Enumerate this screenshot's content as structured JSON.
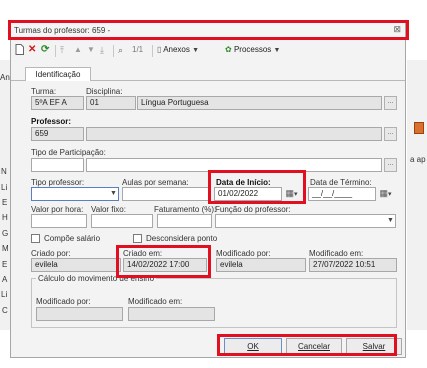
{
  "background": {
    "left_labels": [
      "An",
      "N",
      "Li",
      "E",
      "H",
      "G",
      "M",
      "E",
      "A",
      "Li",
      "C"
    ],
    "right_label": "a ap"
  },
  "dialog": {
    "title": "Turmas do professor: 659 -",
    "close_glyph": "⊠"
  },
  "toolbar": {
    "page_counter": "1/1",
    "anexos_label": "Anexos",
    "processos_label": "Processos"
  },
  "tabs": [
    {
      "label": "Identificação"
    }
  ],
  "form": {
    "turma": {
      "label": "Turma:",
      "value": "5ºA EF A"
    },
    "disciplina": {
      "label": "Disciplina:",
      "code": "01",
      "name": "Língua Portuguesa"
    },
    "professor": {
      "label": "Professor:",
      "code": "659",
      "name": ""
    },
    "tipo_participacao": {
      "label": "Tipo de Participação:",
      "value": ""
    },
    "tipo_professor": {
      "label": "Tipo professor:",
      "value": ""
    },
    "aulas_semana": {
      "label": "Aulas por semana:",
      "value": ""
    },
    "data_inicio": {
      "label": "Data de Início:",
      "value": "01/02/2022"
    },
    "data_termino": {
      "label": "Data de Término:",
      "value": "__/__/____"
    },
    "valor_hora": {
      "label": "Valor por hora:",
      "value": ""
    },
    "valor_fixo": {
      "label": "Valor fixo:",
      "value": ""
    },
    "faturamento": {
      "label": "Faturamento (%):",
      "value": ""
    },
    "funcao_professor": {
      "label": "Função do professor:",
      "value": ""
    },
    "compoe_salario": {
      "label": "Compõe salário",
      "checked": false
    },
    "desconsidera_ponto": {
      "label": "Desconsidera ponto",
      "checked": false
    },
    "criado_por": {
      "label": "Criado por:",
      "value": "evilela"
    },
    "criado_em": {
      "label": "Criado em:",
      "value": "14/02/2022 17:00"
    },
    "modificado_por": {
      "label": "Modificado por:",
      "value": "evilela"
    },
    "modificado_em": {
      "label": "Modificado em:",
      "value": "27/07/2022 10:51"
    },
    "calculo": {
      "title": "Cálculo do movimento de ensino",
      "modificado_por": {
        "label": "Modificado por:",
        "value": ""
      },
      "modificado_em": {
        "label": "Modificado em:",
        "value": ""
      }
    }
  },
  "buttons": {
    "ok": "OK",
    "cancelar": "Cancelar",
    "salvar": "Salvar"
  },
  "colors": {
    "highlight": "#e01020",
    "accent": "#2a7d2a"
  }
}
